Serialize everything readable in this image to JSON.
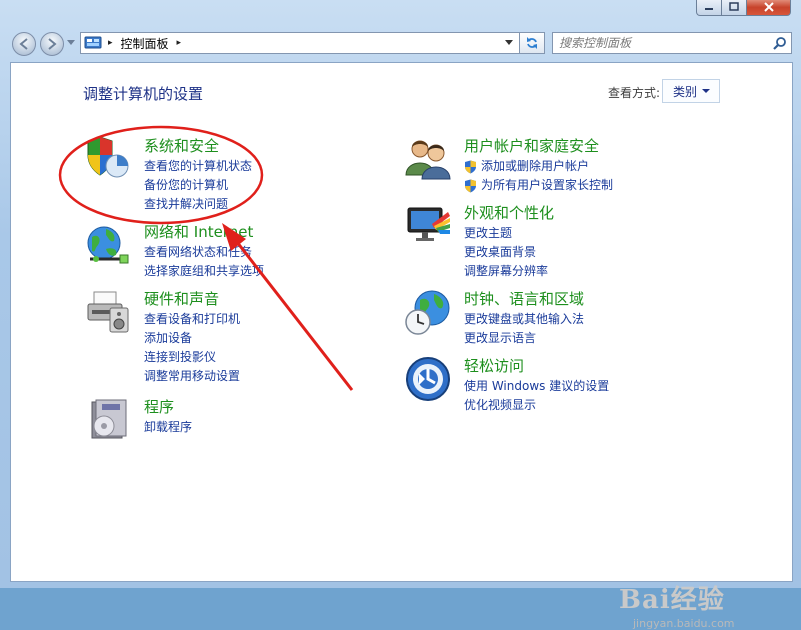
{
  "window": {
    "minimize_label": "─",
    "maximize_label": "□",
    "close_label": "✕"
  },
  "nav": {
    "breadcrumb_sep": "▸",
    "location": "控制面板",
    "search_placeholder": "搜索控制面板"
  },
  "main": {
    "heading": "调整计算机的设置",
    "view_by_label": "查看方式:",
    "view_by_value": "类别"
  },
  "categories": [
    {
      "title": "系统和安全",
      "links": [
        "查看您的计算机状态",
        "备份您的计算机",
        "查找并解决问题"
      ]
    },
    {
      "title": "网络和 Internet",
      "links": [
        "查看网络状态和任务",
        "选择家庭组和共享选项"
      ]
    },
    {
      "title": "硬件和声音",
      "links": [
        "查看设备和打印机",
        "添加设备",
        "连接到投影仪",
        "调整常用移动设置"
      ]
    },
    {
      "title": "程序",
      "links": [
        "卸载程序"
      ]
    },
    {
      "title": "用户帐户和家庭安全",
      "links": [
        "添加或删除用户帐户",
        "为所有用户设置家长控制"
      ]
    },
    {
      "title": "外观和个性化",
      "links": [
        "更改主题",
        "更改桌面背景",
        "调整屏幕分辨率"
      ]
    },
    {
      "title": "时钟、语言和区域",
      "links": [
        "更改键盘或其他输入法",
        "更改显示语言"
      ]
    },
    {
      "title": "轻松访问",
      "links": [
        "使用 Windows 建议的设置",
        "优化视频显示"
      ]
    }
  ],
  "watermark": {
    "text": "Bai经验",
    "url": "jingyan.baidu.com"
  },
  "colors": {
    "category_title": "#1d8f1d",
    "link": "#1a3b9a",
    "heading": "#1e3287",
    "annotation_red": "#e0201b"
  }
}
